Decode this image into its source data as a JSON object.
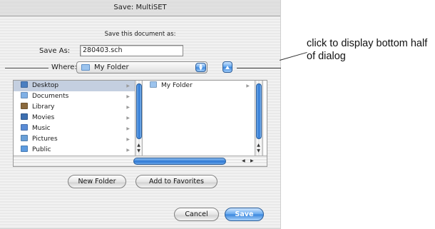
{
  "window": {
    "title": "Save: MultiSET"
  },
  "prompt": "Save this document as:",
  "save_as": {
    "label": "Save As:",
    "value": "280403.sch"
  },
  "where": {
    "label": "Where:",
    "selected": "My Folder",
    "folder_icon": "folder-icon"
  },
  "browser": {
    "column1": [
      {
        "label": "Desktop",
        "icon": "desktop-icon",
        "color": "#4a7fc1",
        "selected": true
      },
      {
        "label": "Documents",
        "icon": "folder-icon",
        "color": "#7fb0e6"
      },
      {
        "label": "Library",
        "icon": "folder-icon",
        "color": "#8b6a3d"
      },
      {
        "label": "Movies",
        "icon": "folder-icon",
        "color": "#3d6fb0"
      },
      {
        "label": "Music",
        "icon": "folder-icon",
        "color": "#5a8cd6"
      },
      {
        "label": "Pictures",
        "icon": "folder-icon",
        "color": "#6aa0d8"
      },
      {
        "label": "Public",
        "icon": "folder-icon",
        "color": "#5c9be0"
      }
    ],
    "column2": [
      {
        "label": "My Folder",
        "icon": "folder-icon",
        "color": "#9cc4ee"
      }
    ]
  },
  "buttons": {
    "new_folder": "New Folder",
    "add_to_favorites": "Add to Favorites",
    "cancel": "Cancel",
    "save": "Save"
  },
  "annotation": "click to display bottom half of dialog",
  "colors": {
    "accent": "#3a84db",
    "selection": "#c4cfe0"
  }
}
